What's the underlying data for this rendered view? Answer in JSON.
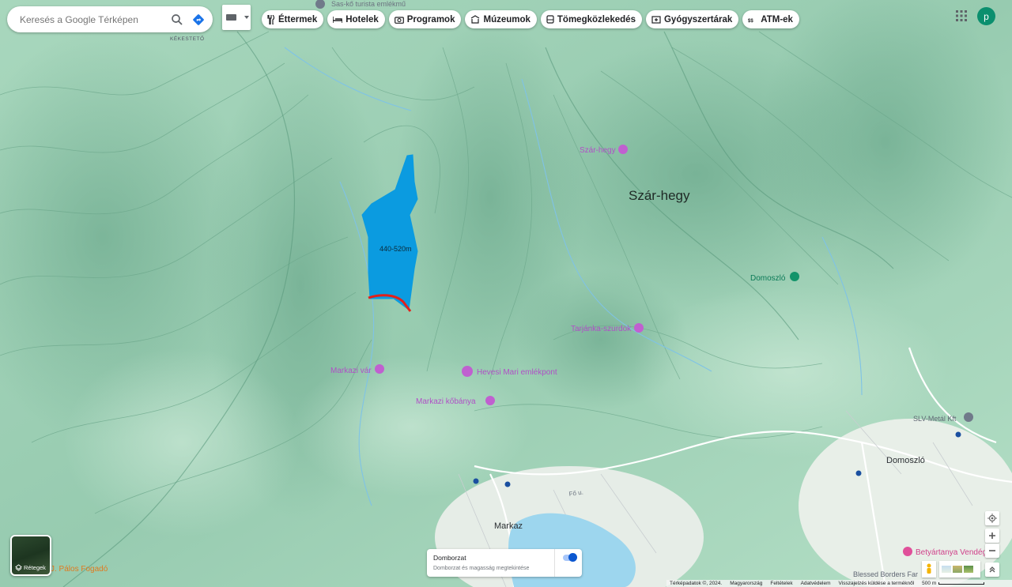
{
  "search": {
    "placeholder": "Keresés a Google Térképen"
  },
  "chips": [
    {
      "label": "Éttermek",
      "icon": "fork-knife-icon"
    },
    {
      "label": "Hotelek",
      "icon": "bed-icon"
    },
    {
      "label": "Programok",
      "icon": "camera-icon"
    },
    {
      "label": "Múzeumok",
      "icon": "museum-icon"
    },
    {
      "label": "Tömegközlekedés",
      "icon": "transit-icon"
    },
    {
      "label": "Gyógyszertárak",
      "icon": "pharmacy-icon"
    },
    {
      "label": "ATM-ek",
      "icon": "atm-icon"
    }
  ],
  "account": {
    "initial": "p"
  },
  "map_labels": {
    "kekesteto": "KÉKESTETŐ",
    "sas_ko": "Sas-kő turista emlékmű",
    "szar_hegy_poi": "Szár-hegy",
    "szar_hegy_title": "Szár-hegy",
    "domoszlo_poi": "Domoszló",
    "tarjanka": "Tarjánka-szurdok",
    "markazi_var": "Markazi vár",
    "hevesi_mari": "Hevesi Mari emlékpont",
    "markazi_kobanya": "Markazi kőbánya",
    "slv_metal": "SLV-Metál Kft",
    "domoszlo_town": "Domoszló",
    "markaz_town": "Markaz",
    "fo_u": "Fő u.",
    "palos": "J. Pálos Fogadó",
    "betyartanya": "Betyártanya Vendég",
    "blessed": "Blessed Borders Far"
  },
  "overlay": {
    "elevation_label": "440-520m"
  },
  "layers_button": {
    "label": "Rétegek"
  },
  "terrain_card": {
    "title": "Domborzat",
    "subtitle": "Domborzat és magasság megtekintése",
    "enabled": true
  },
  "footer": {
    "copyright": "Térképadatok ©, 2024.",
    "country": "Magyarország",
    "terms": "Feltételek",
    "privacy": "Adatvédelem",
    "feedback": "Visszajelzés küldése a terméknől",
    "scale": "500 m"
  },
  "colors": {
    "terrain": "#9fd0b5",
    "overlay_blue": "#0b9be0",
    "overlay_red": "#e3201a",
    "poi_pink": "#c060d0",
    "accent": "#0b57d0"
  }
}
